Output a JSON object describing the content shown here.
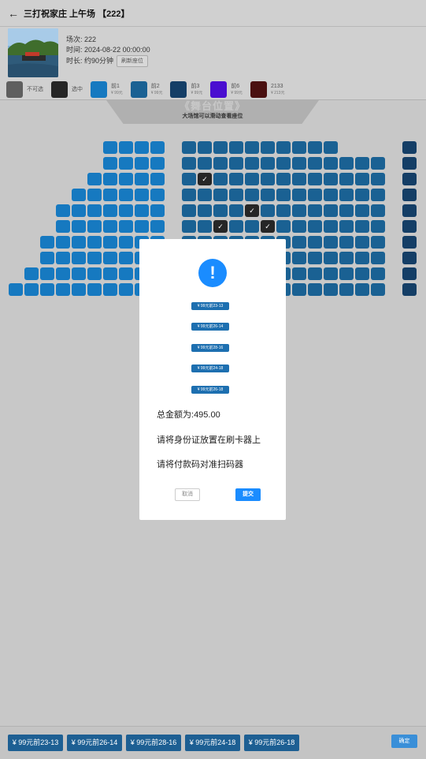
{
  "header": {
    "back_icon": "←",
    "title": "三打祝家庄 上午场 【222】"
  },
  "info": {
    "session_label": "场次:",
    "session_value": "222",
    "time_label": "时间:",
    "time_value": "2024-08-22 00:00:00",
    "duration_label": "时长:",
    "duration_value": "约90分钟",
    "reset_button": "刷新座位"
  },
  "legend": [
    {
      "label": "不可选",
      "price": "",
      "color": "#5f5f5f"
    },
    {
      "label": "选中",
      "price": "",
      "color": "#262626"
    },
    {
      "label": "前1",
      "price": "¥ 99元",
      "color": "#1679c0"
    },
    {
      "label": "前2",
      "price": "¥ 99元",
      "color": "#1a6193"
    },
    {
      "label": "前3",
      "price": "¥ 99元",
      "color": "#143e66"
    },
    {
      "label": "前6",
      "price": "¥ 99元",
      "color": "#4a0ed0"
    },
    {
      "label": "2133",
      "price": "¥ 213元",
      "color": "#4a1010"
    }
  ],
  "stage": {
    "title": "《舞台位置》",
    "hint": "大场馆可以滑动查看座位"
  },
  "selected_mark": "✓",
  "modal": {
    "icon": "!",
    "tickets": [
      "¥ 99元前23-13",
      "¥ 99元前26-14",
      "¥ 99元前28-16",
      "¥ 99元前24-18",
      "¥ 99元前26-18"
    ],
    "total_label": "总金额为:",
    "total_value": "495.00",
    "id_hint": "请将身份证放置在刷卡器上",
    "pay_hint": "请将付款码对准扫码器",
    "cancel": "取消",
    "submit": "提交"
  },
  "bottom": {
    "chips": [
      "¥ 99元前23-13",
      "¥ 99元前26-14",
      "¥ 99元前28-16",
      "¥ 99元前24-18",
      "¥ 99元前26-18"
    ],
    "confirm": "确定"
  }
}
